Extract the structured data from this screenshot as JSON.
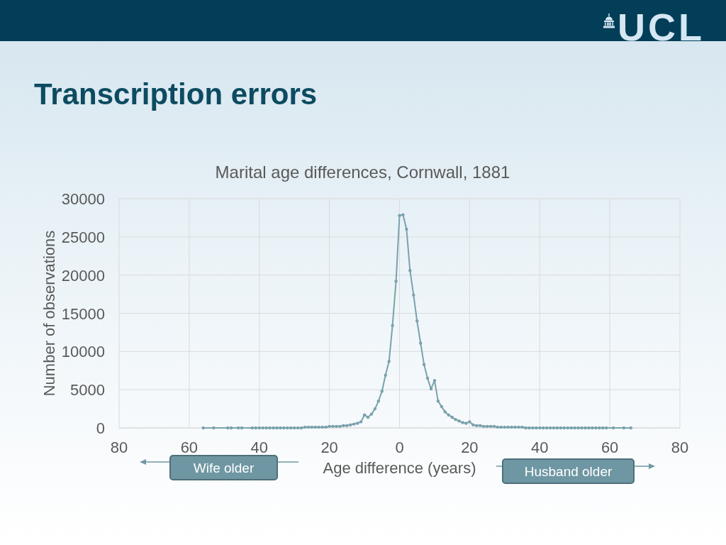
{
  "header": {
    "logo": "UCL"
  },
  "title": "Transcription errors",
  "chart": {
    "chart_data": {
      "type": "line",
      "title": "Marital age differences, Cornwall, 1881",
      "xlabel": "Age difference (years)",
      "ylabel": "Number of observations",
      "grid": true,
      "x": [
        -56,
        -53,
        -49,
        -48,
        -46,
        -45,
        -42,
        -41,
        -40,
        -39,
        -38,
        -37,
        -36,
        -35,
        -34,
        -33,
        -32,
        -31,
        -30,
        -29,
        -28,
        -27,
        -26,
        -25,
        -24,
        -23,
        -22,
        -21,
        -20,
        -19,
        -18,
        -17,
        -16,
        -15,
        -14,
        -13,
        -12,
        -11,
        -10,
        -9,
        -8,
        -7,
        -6,
        -5,
        -4,
        -3,
        -2,
        -1,
        0,
        1,
        2,
        3,
        4,
        5,
        6,
        7,
        8,
        9,
        10,
        11,
        12,
        13,
        14,
        15,
        16,
        17,
        18,
        19,
        20,
        21,
        22,
        23,
        24,
        25,
        26,
        27,
        28,
        29,
        30,
        31,
        32,
        33,
        34,
        35,
        36,
        37,
        38,
        39,
        40,
        41,
        42,
        43,
        44,
        45,
        46,
        47,
        48,
        49,
        50,
        51,
        52,
        53,
        54,
        55,
        56,
        57,
        58,
        59,
        61,
        64,
        66
      ],
      "values": [
        0,
        0,
        0,
        0,
        0,
        0,
        0,
        0,
        0,
        0,
        0,
        0,
        0,
        0,
        0,
        0,
        0,
        0,
        0,
        0,
        0,
        100,
        100,
        100,
        100,
        100,
        100,
        100,
        200,
        200,
        200,
        200,
        300,
        300,
        400,
        500,
        600,
        800,
        1700,
        1400,
        1800,
        2500,
        3500,
        4800,
        6900,
        8700,
        13400,
        19200,
        27800,
        27900,
        26000,
        20600,
        17400,
        14000,
        11100,
        8300,
        6500,
        5100,
        6200,
        3500,
        2800,
        2100,
        1700,
        1400,
        1100,
        900,
        700,
        600,
        800,
        400,
        300,
        300,
        200,
        200,
        200,
        200,
        100,
        100,
        100,
        100,
        100,
        100,
        100,
        100,
        0,
        0,
        0,
        0,
        0,
        0,
        0,
        0,
        0,
        0,
        0,
        0,
        0,
        0,
        0,
        0,
        0,
        0,
        0,
        0,
        0,
        0,
        0,
        0,
        0,
        0,
        0
      ],
      "xlim": [
        -80,
        80
      ],
      "ylim": [
        0,
        30000
      ],
      "xticks": [
        {
          "value": -80,
          "label": "80"
        },
        {
          "value": -60,
          "label": "60"
        },
        {
          "value": -40,
          "label": "40"
        },
        {
          "value": -20,
          "label": "20"
        },
        0,
        20,
        40,
        60,
        80
      ],
      "yticks": [
        0,
        5000,
        10000,
        15000,
        20000,
        25000,
        30000
      ]
    },
    "callouts": [
      {
        "text": "Wife older",
        "kind": "left"
      },
      {
        "text": "Husband older",
        "kind": "right"
      }
    ]
  }
}
